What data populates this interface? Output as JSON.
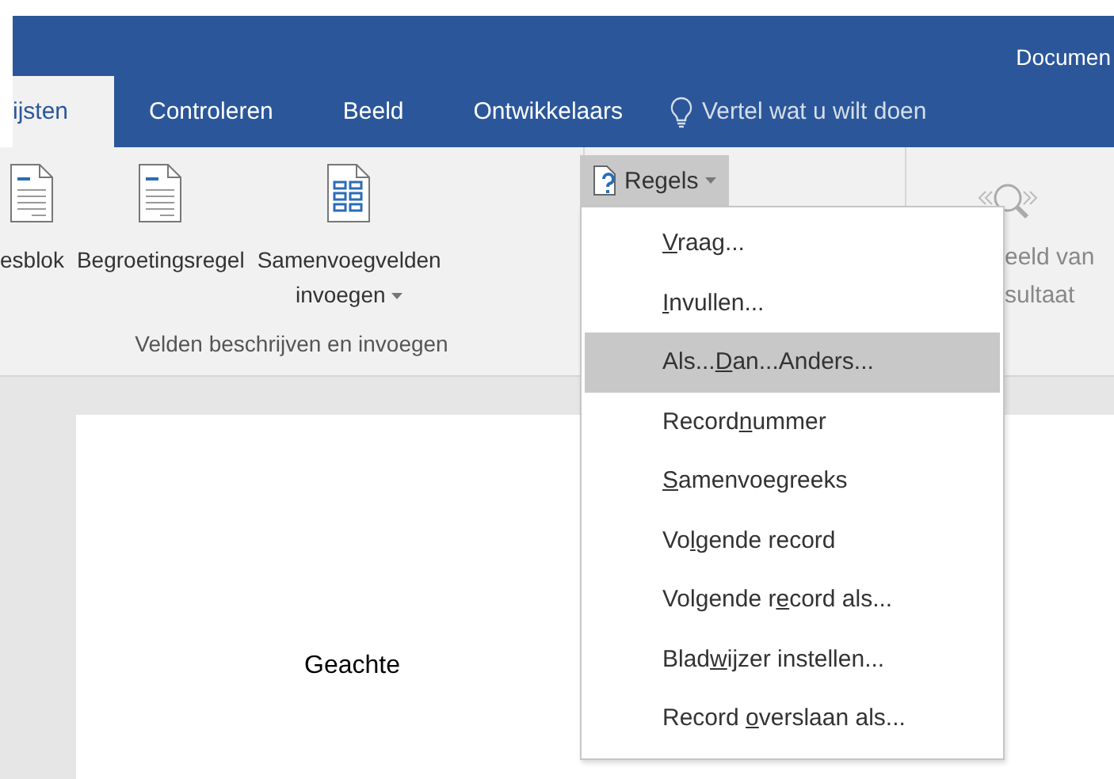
{
  "window": {
    "title": "Documen"
  },
  "tabs": [
    {
      "label": "ijsten",
      "selected": true
    },
    {
      "label": "Controleren",
      "selected": false
    },
    {
      "label": "Beeld",
      "selected": false
    },
    {
      "label": "Ontwikkelaars",
      "selected": false
    }
  ],
  "tell_me": {
    "placeholder": "Vertel wat u wilt doen"
  },
  "ribbon": {
    "group": {
      "label": "Velden beschrijven en invoegen",
      "buttons": [
        {
          "kind": "doc",
          "label": "esblok"
        },
        {
          "kind": "doc",
          "label": "Begroetingsregel"
        },
        {
          "kind": "grid",
          "label": "Samenvoegvelden",
          "label_2": "invoegen",
          "dropdown": true
        }
      ]
    },
    "rules_button": {
      "label": "Regels",
      "open": true
    },
    "preview": {
      "line_1": "eeld van",
      "line_2": "sultaat"
    }
  },
  "menu": {
    "items": [
      {
        "key": "V",
        "after": "raag...",
        "highlighted": false
      },
      {
        "key": "I",
        "after": "nvullen...",
        "highlighted": false
      },
      {
        "before": "Als...",
        "key": "D",
        "after": "an...Anders...",
        "highlighted": true
      },
      {
        "before": "Record",
        "key": "n",
        "after": "ummer",
        "highlighted": false
      },
      {
        "key": "S",
        "after": "amenvoegreeks",
        "highlighted": false
      },
      {
        "before": "Vo",
        "key": "l",
        "after": "gende record",
        "highlighted": false
      },
      {
        "before": "Volgende r",
        "key": "e",
        "after": "cord als...",
        "highlighted": false
      },
      {
        "before": "Blad",
        "key": "w",
        "after": "ijzer instellen...",
        "highlighted": false
      },
      {
        "before": "Record ",
        "key": "o",
        "after": "verslaan als...",
        "highlighted": false
      }
    ]
  },
  "document": {
    "text": "Geachte"
  }
}
